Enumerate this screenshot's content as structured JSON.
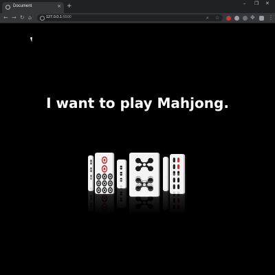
{
  "browser": {
    "tab_title": "Document",
    "tab_close": "×",
    "new_tab": "+",
    "url_host": "127.0.0.1",
    "url_port": ":5500",
    "window_controls": [
      "–",
      "❐",
      "✕"
    ]
  },
  "page": {
    "headline": "I want to play Mahjong."
  },
  "colors": {
    "background": "#000000",
    "tab_strip": "#202124",
    "toolbar": "#35363a",
    "headline": "#ffffff",
    "tile_face": "#f4f4f4",
    "tile_ink": "#1a1a1a",
    "tile_accent": "#b23a3a"
  },
  "tiles": [
    {
      "name": "bamboo-tile-left-edge"
    },
    {
      "name": "circles-tile-red-center"
    },
    {
      "name": "bamboo-tile-narrow"
    },
    {
      "name": "knot-pattern-tile-center"
    },
    {
      "name": "blank-tile-edge"
    },
    {
      "name": "bamboo-tile-right"
    }
  ]
}
